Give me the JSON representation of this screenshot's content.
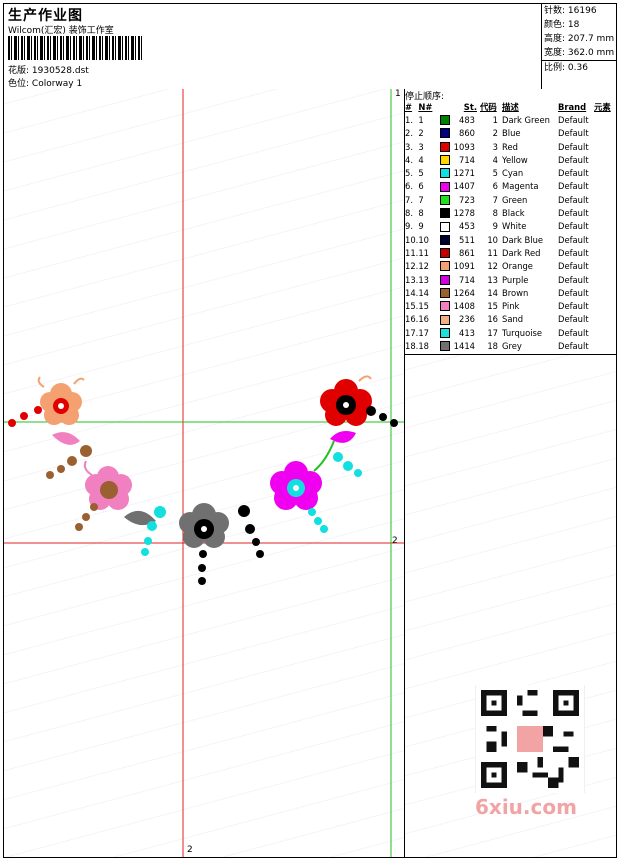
{
  "header": {
    "title": "生产作业图",
    "studio": "Wilcom(汇宏) 装饰工作室",
    "design_label": "花版:",
    "design_value": "1930528.dst",
    "colorway_label": "色位:",
    "colorway_value": "Colorway 1"
  },
  "stats": {
    "stitches_label": "针数:",
    "stitches": "16196",
    "colors_label": "颜色:",
    "colors": "18",
    "height_label": "高度:",
    "height": "207.7 mm",
    "width_label": "宽度:",
    "width": "362.0 mm",
    "scale_label": "比例:",
    "scale": "0.36"
  },
  "stop_sequence": {
    "caption": "停止顺序:",
    "headers": [
      "#",
      "N#",
      "St.",
      "代码",
      "描述",
      "Brand",
      "元素"
    ],
    "rows": [
      {
        "n": "1.",
        "nn": "1",
        "color": "#008000",
        "st": "483",
        "code": "1",
        "desc": "Dark Green",
        "brand": "Default"
      },
      {
        "n": "2.",
        "nn": "2",
        "color": "#000080",
        "st": "860",
        "code": "2",
        "desc": "Blue",
        "brand": "Default"
      },
      {
        "n": "3.",
        "nn": "3",
        "color": "#e00000",
        "st": "1093",
        "code": "3",
        "desc": "Red",
        "brand": "Default"
      },
      {
        "n": "4.",
        "nn": "4",
        "color": "#ffd800",
        "st": "714",
        "code": "4",
        "desc": "Yellow",
        "brand": "Default"
      },
      {
        "n": "5.",
        "nn": "5",
        "color": "#10e0e0",
        "st": "1271",
        "code": "5",
        "desc": "Cyan",
        "brand": "Default"
      },
      {
        "n": "6.",
        "nn": "6",
        "color": "#f000f0",
        "st": "1407",
        "code": "6",
        "desc": "Magenta",
        "brand": "Default"
      },
      {
        "n": "7.",
        "nn": "7",
        "color": "#20e020",
        "st": "723",
        "code": "7",
        "desc": "Green",
        "brand": "Default"
      },
      {
        "n": "8.",
        "nn": "8",
        "color": "#000000",
        "st": "1278",
        "code": "8",
        "desc": "Black",
        "brand": "Default"
      },
      {
        "n": "9.",
        "nn": "9",
        "color": "#ffffff",
        "st": "453",
        "code": "9",
        "desc": "White",
        "brand": "Default"
      },
      {
        "n": "10.",
        "nn": "10",
        "color": "#000030",
        "st": "511",
        "code": "10",
        "desc": "Dark Blue",
        "brand": "Default"
      },
      {
        "n": "11.",
        "nn": "11",
        "color": "#c00000",
        "st": "861",
        "code": "11",
        "desc": "Dark Red",
        "brand": "Default"
      },
      {
        "n": "12.",
        "nn": "12",
        "color": "#f4a070",
        "st": "1091",
        "code": "12",
        "desc": "Orange",
        "brand": "Default"
      },
      {
        "n": "13.",
        "nn": "13",
        "color": "#d000e0",
        "st": "714",
        "code": "13",
        "desc": "Purple",
        "brand": "Default"
      },
      {
        "n": "14.",
        "nn": "14",
        "color": "#9a6030",
        "st": "1264",
        "code": "14",
        "desc": "Brown",
        "brand": "Default"
      },
      {
        "n": "15.",
        "nn": "15",
        "color": "#f080c0",
        "st": "1408",
        "code": "15",
        "desc": "Pink",
        "brand": "Default"
      },
      {
        "n": "16.",
        "nn": "16",
        "color": "#f0b080",
        "st": "236",
        "code": "16",
        "desc": "Sand",
        "brand": "Default"
      },
      {
        "n": "17.",
        "nn": "17",
        "color": "#20e0d8",
        "st": "413",
        "code": "17",
        "desc": "Turquoise",
        "brand": "Default"
      },
      {
        "n": "18.",
        "nn": "18",
        "color": "#707070",
        "st": "1414",
        "code": "18",
        "desc": "Grey",
        "brand": "Default"
      }
    ]
  },
  "canvas": {
    "axis_label_1": "1",
    "axis_label_2_right": "2",
    "axis_label_2_bottom": "2"
  },
  "watermark": {
    "brand": "6xiu.com"
  },
  "colors": {
    "red_line": "#e02020",
    "green_line": "#20c020"
  }
}
